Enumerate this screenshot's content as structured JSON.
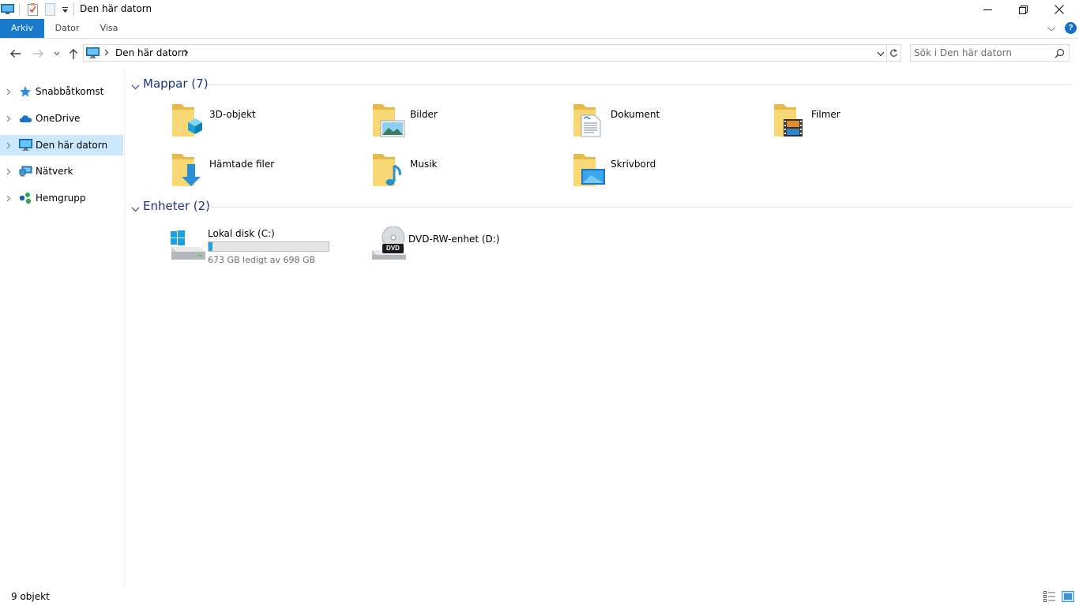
{
  "window": {
    "title": "Den här datorn",
    "controls": {
      "minimize": "minimize",
      "maximize": "restore",
      "close": "close"
    }
  },
  "quick_access_toolbar": {
    "icons": [
      "computer-icon",
      "properties-icon",
      "new-folder-icon",
      "customize-dropdown-icon"
    ]
  },
  "ribbon": {
    "tabs": [
      {
        "label": "Arkiv",
        "active": true
      },
      {
        "label": "Dator",
        "active": false
      },
      {
        "label": "Visa",
        "active": false
      }
    ]
  },
  "navigation": {
    "address": {
      "path": "Den här datorn"
    },
    "search": {
      "placeholder": "Sök i Den här datorn"
    }
  },
  "sidebar": {
    "items": [
      {
        "label": "Snabbåtkomst",
        "icon": "star-icon",
        "selected": false
      },
      {
        "label": "OneDrive",
        "icon": "cloud-icon",
        "selected": false
      },
      {
        "label": "Den här datorn",
        "icon": "computer-icon",
        "selected": true
      },
      {
        "label": "Nätverk",
        "icon": "network-icon",
        "selected": false
      },
      {
        "label": "Hemgrupp",
        "icon": "homegroup-icon",
        "selected": false
      }
    ]
  },
  "content": {
    "groups": [
      {
        "title": "Mappar (7)",
        "items": [
          {
            "label": "3D-objekt",
            "icon": "3d-objects-folder-icon"
          },
          {
            "label": "Bilder",
            "icon": "pictures-folder-icon"
          },
          {
            "label": "Dokument",
            "icon": "documents-folder-icon"
          },
          {
            "label": "Filmer",
            "icon": "videos-folder-icon"
          },
          {
            "label": "Hämtade filer",
            "icon": "downloads-folder-icon"
          },
          {
            "label": "Musik",
            "icon": "music-folder-icon"
          },
          {
            "label": "Skrivbord",
            "icon": "desktop-folder-icon"
          }
        ]
      },
      {
        "title": "Enheter (2)",
        "drives": [
          {
            "label": "Lokal disk (C:)",
            "icon": "local-disk-icon",
            "space_text": "673 GB ledigt av 698 GB",
            "used_fraction": 0.036
          },
          {
            "label": "DVD-RW-enhet (D:)",
            "icon": "dvd-drive-icon",
            "badge": "DVD"
          }
        ]
      }
    ]
  },
  "status": {
    "text": "9 objekt"
  },
  "colors": {
    "accent": "#1979ca",
    "group_title": "#1e3287",
    "selection": "#cce8ff",
    "drive_bar": "#26a0da",
    "folder": "#f8d775"
  }
}
